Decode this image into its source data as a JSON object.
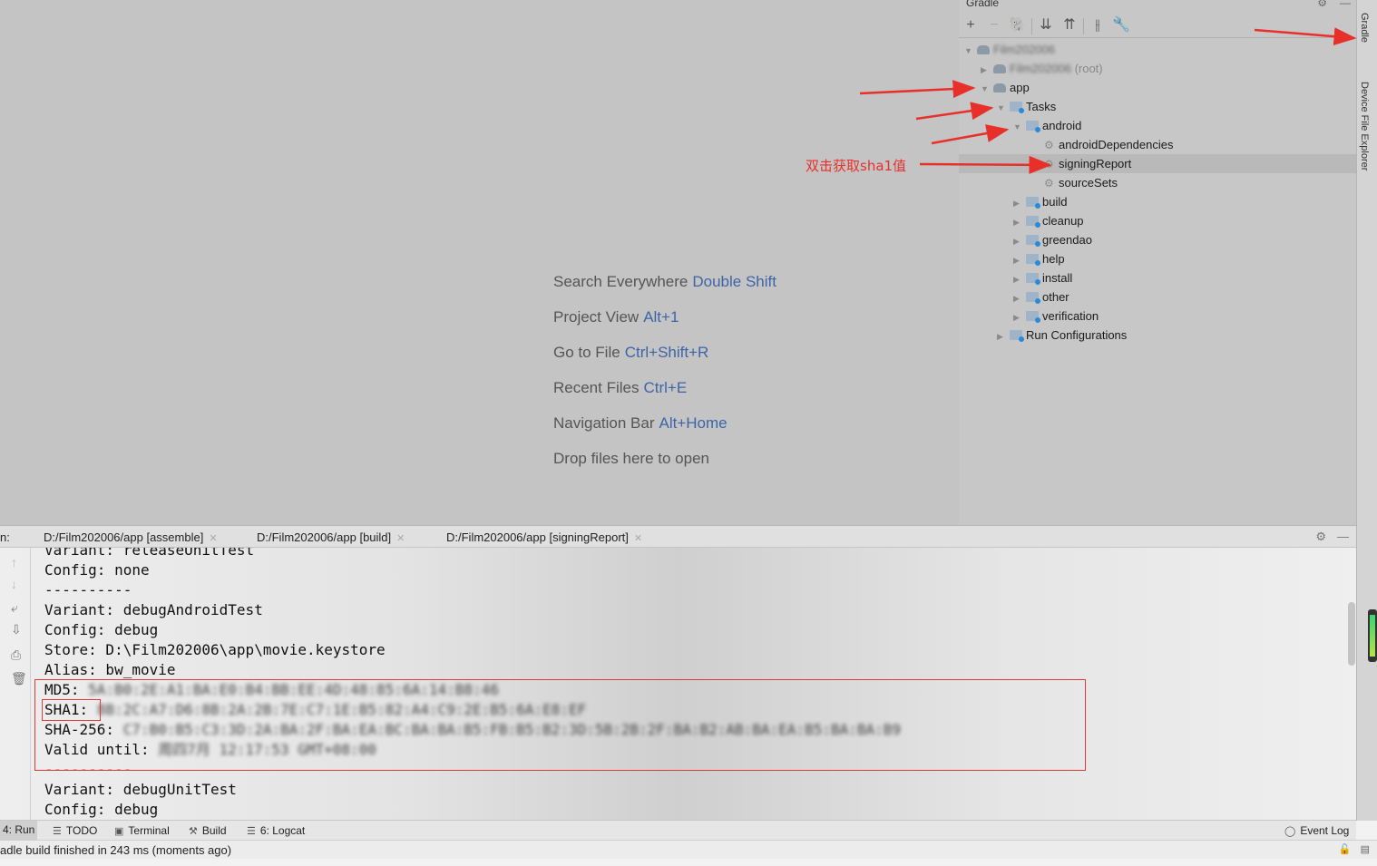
{
  "editor": {
    "hints": [
      {
        "text": "Search Everywhere",
        "key": "Double Shift"
      },
      {
        "text": "Project View",
        "key": "Alt+1"
      },
      {
        "text": "Go to File",
        "key": "Ctrl+Shift+R"
      },
      {
        "text": "Recent Files",
        "key": "Ctrl+E"
      },
      {
        "text": "Navigation Bar",
        "key": "Alt+Home"
      },
      {
        "text": "Drop files here to open",
        "key": ""
      }
    ]
  },
  "gradle": {
    "title": "Gradle",
    "tree": {
      "project": "Film202006",
      "root_module": "Film202006",
      "root_suffix": "(root)",
      "app": "app",
      "tasks": "Tasks",
      "android": "android",
      "android_children": [
        "androidDependencies",
        "signingReport",
        "sourceSets"
      ],
      "task_groups": [
        "build",
        "cleanup",
        "greendao",
        "help",
        "install",
        "other",
        "verification"
      ],
      "run_configurations": "Run Configurations"
    }
  },
  "right_strip": {
    "gradle_tab": "Gradle",
    "device_tab": "Device File Explorer"
  },
  "annotation": {
    "label": "双击获取sha1值",
    "color": "#e8302b"
  },
  "run_panel": {
    "prefix": "n:",
    "tabs": [
      "D:/Film202006/app [assemble]",
      "D:/Film202006/app [build]",
      "D:/Film202006/app [signingReport]"
    ],
    "console": {
      "line_variant_release": "Variant: releaseUnitTest",
      "line_config_none": "Config: none",
      "line_sep1": "----------",
      "line_variant_android": "Variant: debugAndroidTest",
      "line_config_debug": "Config: debug",
      "line_store": "Store: D:\\Film202006\\app\\movie.keystore",
      "line_alias": "Alias: bw_movie",
      "md5_label": "MD5:",
      "md5_value": "5A:B0:2E:A1:BA:E0:B4:BB:EE:4D:48:85:6A:14:B8:46",
      "sha1_label": "SHA1:",
      "sha1_value": "8B:2C:A7:D6:8B:2A:2B:7E:C7:1E:B5:82:A4:C9:2E:B5:6A:E8:EF",
      "sha256_label": "SHA-256:",
      "sha256_value": "C7:B0:B5:C3:3D:2A:BA:2F:BA:EA:BC:BA:BA:B5:FB:B5:B2:3D:5B:2B:2F:BA:B2:AB:BA:EA:B5:BA:BA:B9",
      "valid_label": "Valid until:",
      "valid_value": "周四7月 12:17:53 GMT+08:00",
      "line_sep2": "----------",
      "line_variant_unit": "Variant: debugUnitTest",
      "line_config_debug2": "Config: debug"
    }
  },
  "bottom_toolbar": {
    "run": "4: Run",
    "todo": "TODO",
    "terminal": "Terminal",
    "build": "Build",
    "logcat": "6: Logcat",
    "event_log": "Event Log"
  },
  "status": {
    "text": "adle build finished in 243 ms (moments ago)"
  }
}
